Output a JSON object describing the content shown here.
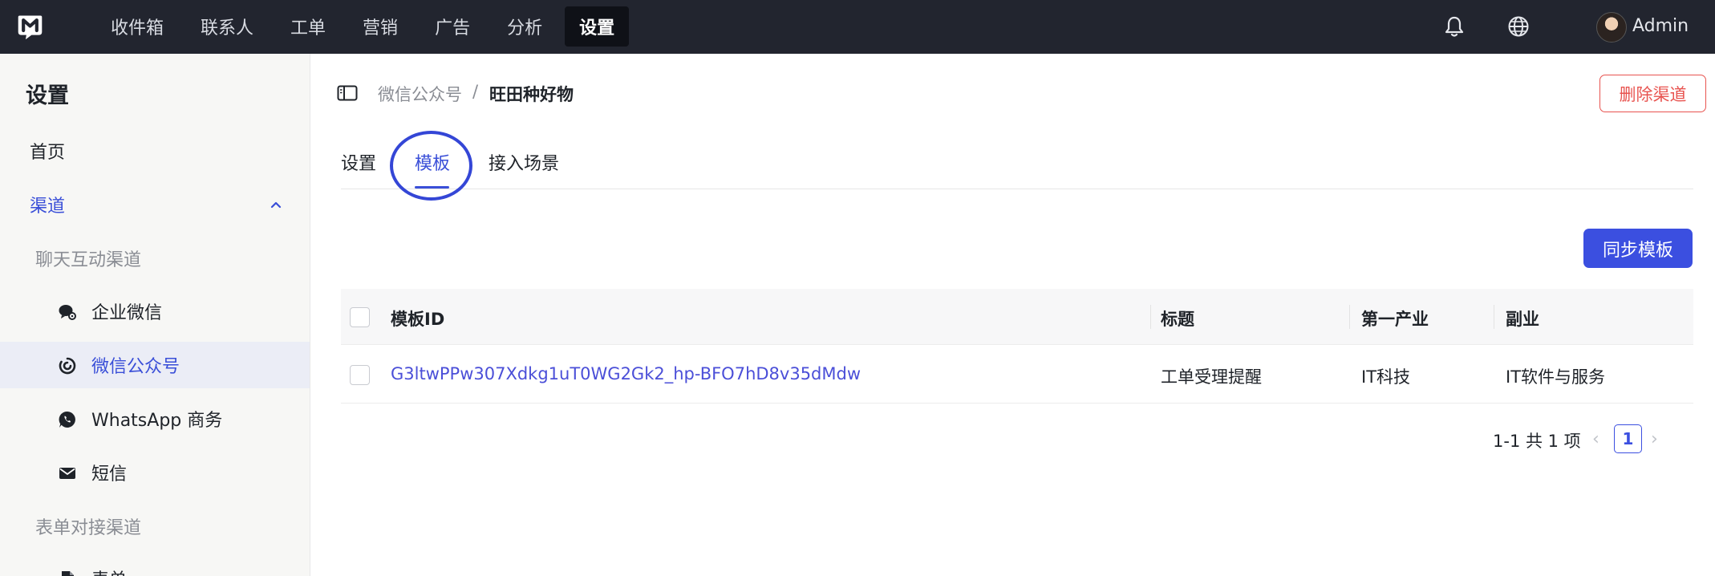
{
  "topnav": {
    "items": [
      "收件箱",
      "联系人",
      "工单",
      "营销",
      "广告",
      "分析",
      "设置"
    ],
    "active": "设置",
    "user_name": "Admin"
  },
  "sidebar": {
    "title": "设置",
    "home": "首页",
    "channels": "渠道",
    "chat_group": "聊天互动渠道",
    "chat_items": [
      "企业微信",
      "微信公众号",
      "WhatsApp 商务",
      "短信"
    ],
    "active_item": "微信公众号",
    "form_group": "表单对接渠道",
    "form_items": [
      "表单"
    ]
  },
  "breadcrumb": {
    "parent": "微信公众号",
    "separator": "/",
    "current": "旺田种好物"
  },
  "delete_button": "删除渠道",
  "tabs": [
    "设置",
    "模板",
    "接入场景"
  ],
  "active_tab": "模板",
  "sync_button": "同步模板",
  "table": {
    "columns": [
      "模板ID",
      "标题",
      "第一产业",
      "副业"
    ],
    "rows": [
      {
        "template_id": "G3ltwPPw307Xdkg1uT0WG2Gk2_hp-BFO7hD8v35dMdw",
        "title": "工单受理提醒",
        "industry_primary": "IT科技",
        "industry_secondary": "IT软件与服务"
      }
    ]
  },
  "pagination": {
    "summary": "1-1 共 1 项",
    "current_page": "1",
    "prev": "‹",
    "next": "›"
  },
  "colors": {
    "accent": "#3b4fe0",
    "danger": "#e8534f",
    "topbar": "#22252f"
  }
}
